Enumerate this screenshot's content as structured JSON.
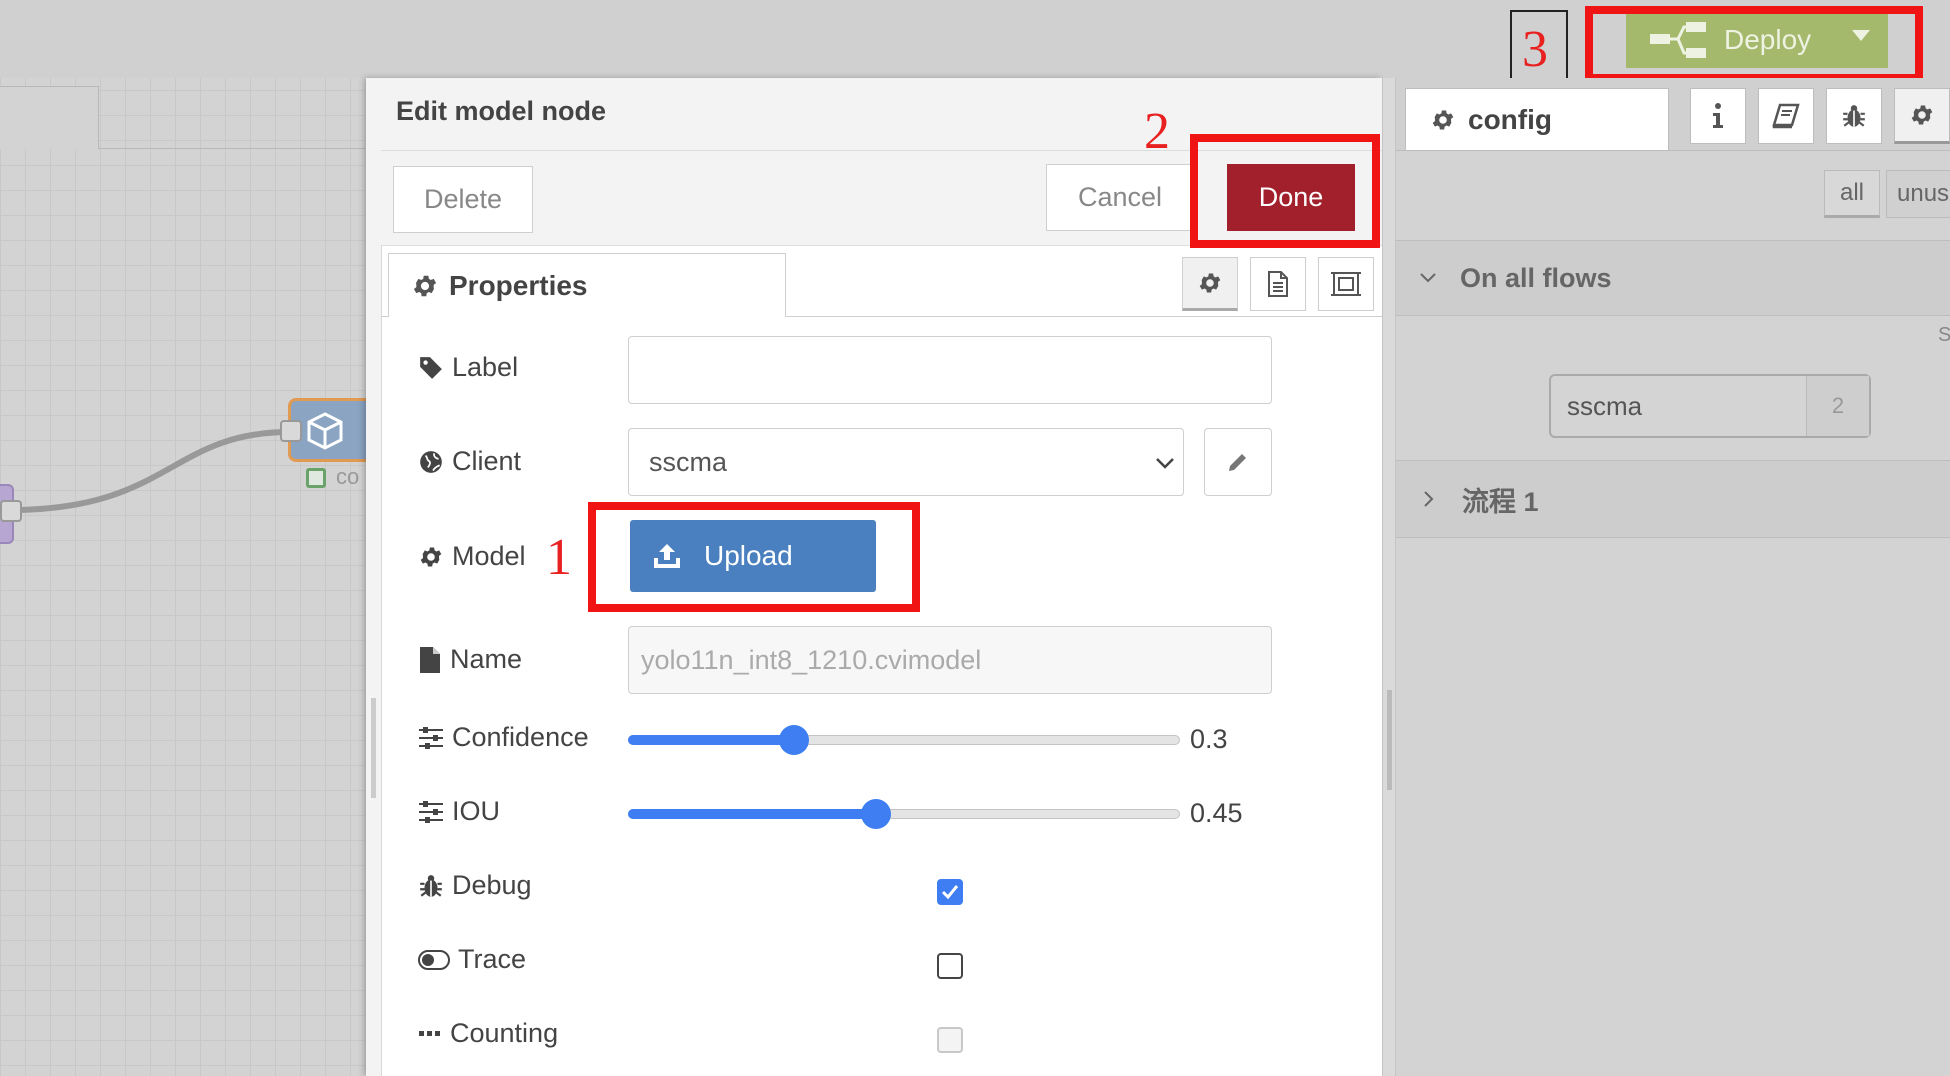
{
  "header": {
    "deploy_label": "Deploy"
  },
  "annotations": {
    "one": "1",
    "two": "2",
    "three": "3"
  },
  "workspace": {
    "node_label_partial": "co"
  },
  "editor": {
    "title": "Edit model node",
    "delete_label": "Delete",
    "cancel_label": "Cancel",
    "done_label": "Done",
    "properties_tab": "Properties",
    "fields": {
      "label": {
        "label": "Label",
        "value": ""
      },
      "client": {
        "label": "Client",
        "value": "sscma"
      },
      "model": {
        "label": "Model",
        "upload_label": "Upload"
      },
      "name": {
        "label": "Name",
        "placeholder": "yolo11n_int8_1210.cvimodel"
      },
      "confidence": {
        "label": "Confidence",
        "value": 0.3,
        "display": "0.3"
      },
      "iou": {
        "label": "IOU",
        "value": 0.45,
        "display": "0.45"
      },
      "debug": {
        "label": "Debug",
        "checked": true
      },
      "trace": {
        "label": "Trace",
        "checked": false
      },
      "counting": {
        "label": "Counting",
        "checked": false,
        "disabled": true
      }
    }
  },
  "sidebar": {
    "tab_label": "config",
    "filter_all": "all",
    "filter_unused": "unus",
    "section_all_flows": "On all flows",
    "node_name": "sscma",
    "node_count": "2",
    "section_flow": "流程 1",
    "right_edge_char": "S"
  },
  "colors": {
    "deploy_bg": "#a4b96b",
    "done_bg": "#a2202c",
    "upload_bg": "#4a80bf",
    "annotation_red": "#f01414",
    "slider_blue": "#3f7ef2"
  }
}
